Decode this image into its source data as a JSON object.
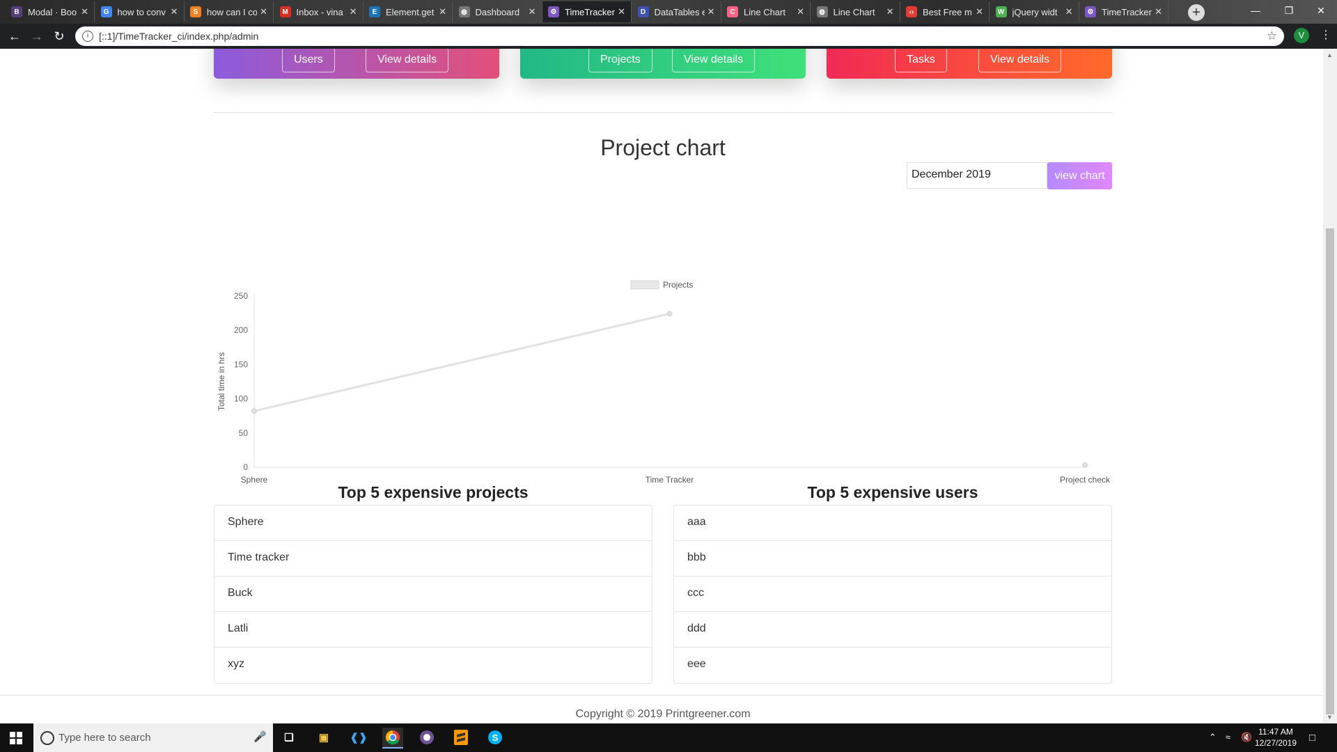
{
  "browser": {
    "tabs": [
      {
        "label": "Modal · Boo",
        "icon": "bootstrap-icon",
        "color": "#563d7c",
        "glyph": "B",
        "active": false
      },
      {
        "label": "how to conv",
        "icon": "google-icon",
        "color": "#4285f4",
        "glyph": "G",
        "active": false
      },
      {
        "label": "how can I co",
        "icon": "stackoverflow-icon",
        "color": "#f48024",
        "glyph": "S",
        "active": false
      },
      {
        "label": "Inbox - vina",
        "icon": "gmail-icon",
        "color": "#d93025",
        "glyph": "M",
        "active": false
      },
      {
        "label": "Element.get",
        "icon": "mdn-icon",
        "color": "#1b74b8",
        "glyph": "E",
        "active": false
      },
      {
        "label": "Dashboard",
        "icon": "globe-icon",
        "color": "#777777",
        "glyph": "◍",
        "active": false
      },
      {
        "label": "TimeTracker",
        "icon": "timetracker-icon",
        "color": "#7e57c2",
        "glyph": "⚙",
        "active": true
      },
      {
        "label": "DataTables e",
        "icon": "datatables-icon",
        "color": "#3f51b5",
        "glyph": "D",
        "active": false
      },
      {
        "label": "Line Chart",
        "icon": "chartjs-icon",
        "color": "#ff6384",
        "glyph": "C",
        "active": false
      },
      {
        "label": "Line Chart",
        "icon": "globe-icon",
        "color": "#777777",
        "glyph": "◍",
        "active": false
      },
      {
        "label": "Best Free m",
        "icon": "code-icon",
        "color": "#e53935",
        "glyph": "‹›",
        "active": false
      },
      {
        "label": "jQuery widt",
        "icon": "w3schools-icon",
        "color": "#4caf50",
        "glyph": "W",
        "active": false
      },
      {
        "label": "TimeTracker",
        "icon": "timetracker-icon",
        "color": "#7e57c2",
        "glyph": "⚙",
        "active": false
      }
    ],
    "url": "[::1]/TimeTracker_ci/index.php/admin",
    "profile_initial": "V"
  },
  "cards": [
    {
      "btn1": "Users",
      "btn2": "View details",
      "gradient": [
        "#8c5bdc",
        "#e2507a"
      ]
    },
    {
      "btn1": "Projects",
      "btn2": "View details",
      "gradient": [
        "#22b886",
        "#3fe07a"
      ]
    },
    {
      "btn1": "Tasks",
      "btn2": "View details",
      "gradient": [
        "#f12a55",
        "#ff6a2a"
      ]
    }
  ],
  "project_chart": {
    "heading": "Project chart",
    "month_value": "December 2019",
    "view_button": "view chart"
  },
  "chart_data": {
    "type": "line",
    "categories": [
      "Sphere",
      "Time Tracker",
      "Project check"
    ],
    "series": [
      {
        "name": "Projects",
        "values": [
          82,
          224,
          3
        ]
      }
    ],
    "xlabel": "",
    "ylabel": "Total time in hrs",
    "ylim": [
      0,
      250
    ],
    "yticks": [
      0,
      50,
      100,
      150,
      200,
      250
    ],
    "legend": "top",
    "grid": false,
    "line_color": "#e2e2e2"
  },
  "top_projects": {
    "title": "Top 5 expensive projects",
    "items": [
      "Sphere",
      "Time tracker",
      "Buck",
      "Latli",
      "xyz"
    ]
  },
  "top_users": {
    "title": "Top 5 expensive users",
    "items": [
      "aaa",
      "bbb",
      "ccc",
      "ddd",
      "eee"
    ]
  },
  "footer": {
    "copyright": "Copyright © 2019 Printgreener.com"
  },
  "taskbar": {
    "search_placeholder": "Type here to search",
    "time": "11:47 AM",
    "date": "12/27/2019"
  }
}
